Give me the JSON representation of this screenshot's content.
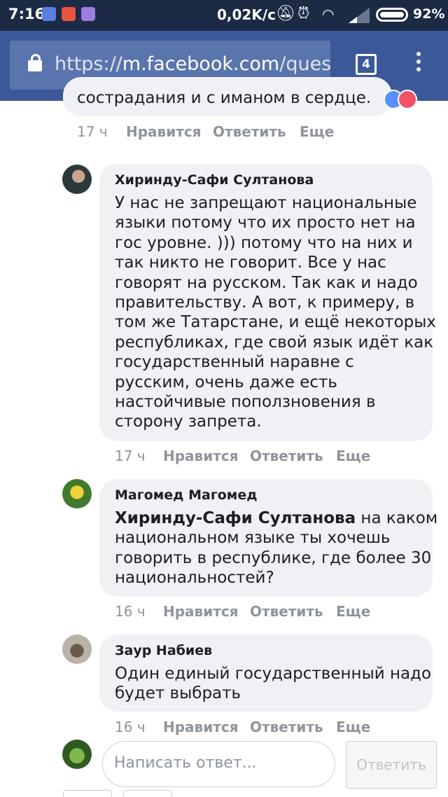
{
  "status_bar": {
    "time": "7:16",
    "speed": "0,02K/c",
    "battery": "92%"
  },
  "browser": {
    "url_scheme": "https://",
    "url_host": "m.facebook.com",
    "url_path": "/ques",
    "tab_count": "4"
  },
  "top_comment": {
    "text_cut": "сострадания и с иманом в сердце.",
    "time": "17 ч",
    "like": "Нравится",
    "reply": "Ответить",
    "more": "Еще"
  },
  "comments": [
    {
      "author": "Хиринду-Сафи Султанова",
      "lines": [
        "У нас не запрещают национальные",
        "языки потому что их просто нет на",
        "гос уровне. ))) потому что на них и",
        "так никто не говорит. Все у нас",
        "говорят на русском. Так как и надо",
        "правительству. А вот, к примеру, в",
        "том же Татарстане, и ещё некоторых",
        "республиках, где свой язык идёт как",
        "государственный наравне с",
        "русским, очень даже есть",
        "настойчивые поползновения в",
        "сторону запрета."
      ],
      "time": "17 ч",
      "like": "Нравится",
      "reply": "Ответить",
      "more": "Еще"
    },
    {
      "author": "Магомед Магомед",
      "mention": "Хиринду-Сафи Султанова",
      "first_line_rest": " на каком",
      "lines": [
        "национальном языке ты хочешь",
        "говорить в республике, где более 30",
        "национальностей?"
      ],
      "time": "16 ч",
      "like": "Нравится",
      "reply": "Ответить",
      "more": "Еще"
    },
    {
      "author": "Заур Набиев",
      "lines": [
        "Один единый государственный надо",
        "будет выбрать"
      ],
      "time": "16 ч",
      "like": "Нравится",
      "reply": "Ответить",
      "more": "Еще"
    }
  ],
  "reply_box": {
    "placeholder": "Написать ответ...",
    "submit": "Ответить"
  },
  "icons": {
    "messenger": "messenger-icon",
    "aliexpress": "aliexpress-icon",
    "gallery": "gallery-icon",
    "mute": "mute-icon",
    "alarm": "alarm-icon",
    "wifi": "wifi-icon",
    "signal": "signal-icon",
    "battery": "battery-icon",
    "lock": "lock-icon",
    "menu": "menu-dots-icon"
  },
  "colors": {
    "status_bar": "#1d2a45",
    "facebook_blue": "#3b5998",
    "bubble": "#f0f1f4",
    "meta_text": "#90949c"
  }
}
